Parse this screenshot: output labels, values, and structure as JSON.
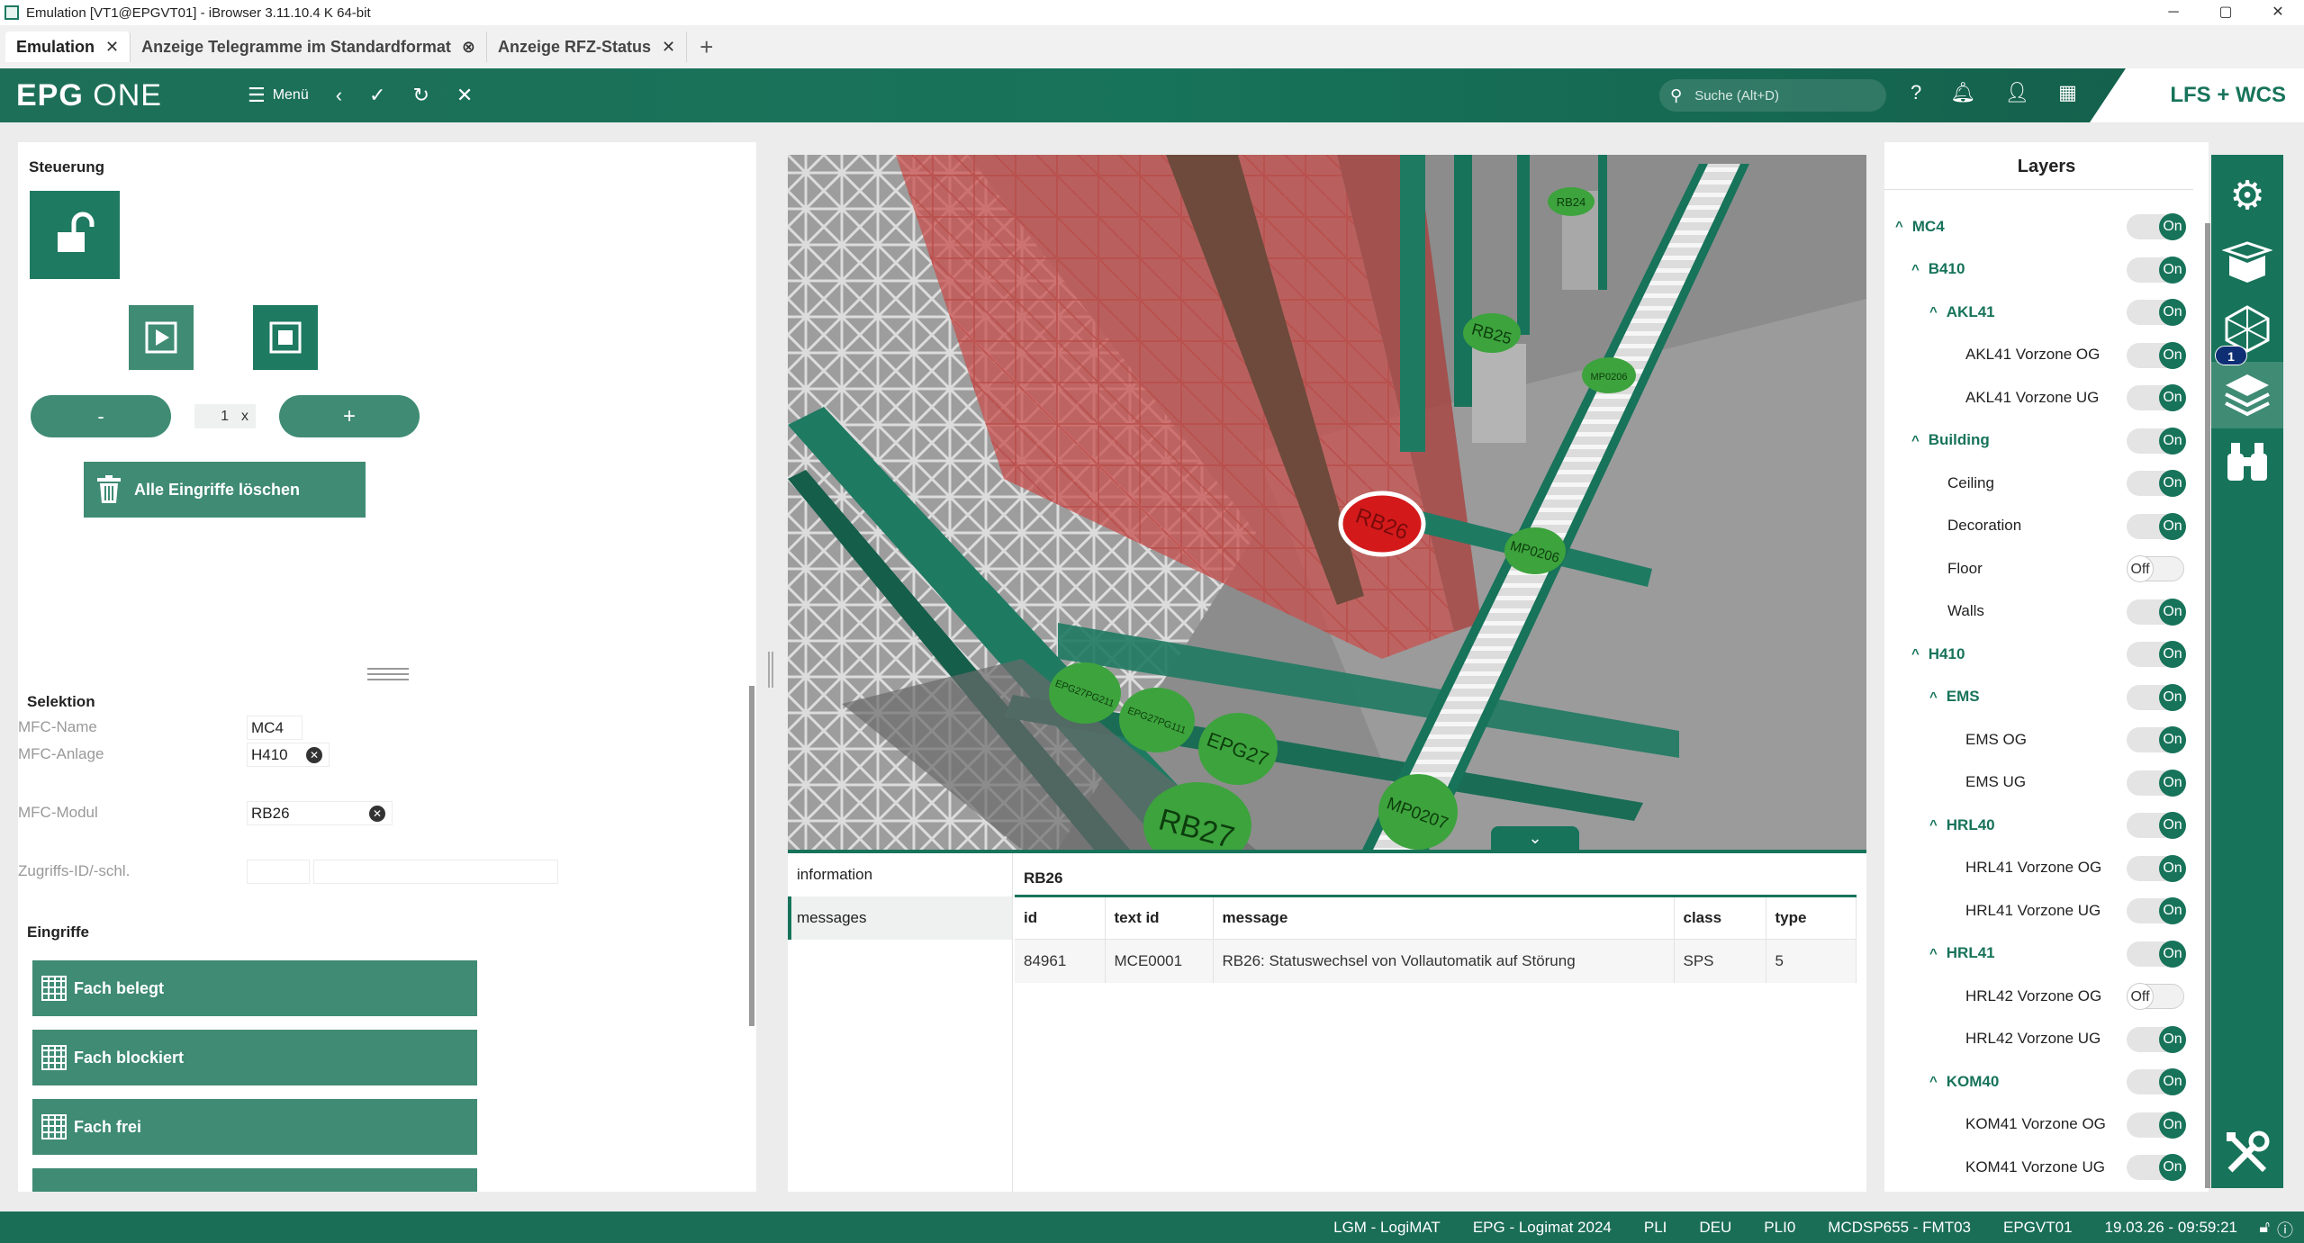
{
  "window": {
    "title": "Emulation [VT1@EPGVT01] - iBrowser 3.11.10.4 K 64-bit",
    "minimize": "─",
    "maximize": "▢",
    "close": "✕"
  },
  "tabs": [
    {
      "label": "Emulation"
    },
    {
      "label": "Anzeige Telegramme im Standardformat"
    },
    {
      "label": "Anzeige RFZ-Status"
    }
  ],
  "header": {
    "logo_bold": "EPG",
    "logo_light": "ONE",
    "menu_label": "Menü",
    "search_placeholder": "Suche (Alt+D)",
    "brand": "LFS + WCS"
  },
  "steuerung": {
    "title": "Steuerung",
    "speed_value": "1",
    "speed_unit": "x",
    "minus_label": "-",
    "plus_label": "+",
    "clear_label": "Alle Eingriffe löschen"
  },
  "selektion": {
    "title": "Selektion",
    "mfc_name_label": "MFC-Name",
    "mfc_name_value": "MC4",
    "mfc_anlage_label": "MFC-Anlage",
    "mfc_anlage_value": "H410",
    "mfc_modul_label": "MFC-Modul",
    "mfc_modul_value": "RB26",
    "zugriffs_label": "Zugriffs-ID/-schl."
  },
  "eingriffe": {
    "title": "Eingriffe",
    "buttons": [
      "Fach belegt",
      "Fach blockiert",
      "Fach frei"
    ]
  },
  "scene_labels": {
    "rb26": "RB26",
    "rb25": "RB25",
    "rb24": "RB24",
    "rb27": "RB27",
    "epg27": "EPG27",
    "mp0206a": "MP0206",
    "mp0206b": "MP0206",
    "mp0207": "MP0207",
    "epg27pg211": "EPG27PG211",
    "epg27pg111": "EPG27PG111"
  },
  "info": {
    "tabs": [
      "information",
      "messages"
    ],
    "title": "RB26",
    "columns": [
      "id",
      "text id",
      "message",
      "class",
      "type"
    ],
    "rows": [
      [
        "84961",
        "MCE0001",
        "RB26: Statuswechsel von Vollautomatik auf Störung",
        "SPS",
        "5"
      ]
    ]
  },
  "layers": {
    "title": "Layers",
    "on_label": "On",
    "off_label": "Off",
    "items": [
      {
        "label": "MC4",
        "level": 0,
        "group": true,
        "on": true
      },
      {
        "label": "B410",
        "level": 1,
        "group": true,
        "on": true
      },
      {
        "label": "AKL41",
        "level": 2,
        "group": true,
        "on": true
      },
      {
        "label": "AKL41 Vorzone OG",
        "level": 3,
        "group": false,
        "on": true
      },
      {
        "label": "AKL41 Vorzone UG",
        "level": 3,
        "group": false,
        "on": true
      },
      {
        "label": "Building",
        "level": 1,
        "group": true,
        "on": true
      },
      {
        "label": "Ceiling",
        "level": 2,
        "group": false,
        "on": true
      },
      {
        "label": "Decoration",
        "level": 2,
        "group": false,
        "on": true
      },
      {
        "label": "Floor",
        "level": 2,
        "group": false,
        "on": false
      },
      {
        "label": "Walls",
        "level": 2,
        "group": false,
        "on": true
      },
      {
        "label": "H410",
        "level": 1,
        "group": true,
        "on": true
      },
      {
        "label": "EMS",
        "level": 2,
        "group": true,
        "on": true
      },
      {
        "label": "EMS OG",
        "level": 3,
        "group": false,
        "on": true
      },
      {
        "label": "EMS UG",
        "level": 3,
        "group": false,
        "on": true
      },
      {
        "label": "HRL40",
        "level": 2,
        "group": true,
        "on": true
      },
      {
        "label": "HRL41 Vorzone OG",
        "level": 3,
        "group": false,
        "on": true
      },
      {
        "label": "HRL41 Vorzone UG",
        "level": 3,
        "group": false,
        "on": true
      },
      {
        "label": "HRL41",
        "level": 2,
        "group": true,
        "on": true
      },
      {
        "label": "HRL42 Vorzone OG",
        "level": 3,
        "group": false,
        "on": false
      },
      {
        "label": "HRL42 Vorzone UG",
        "level": 3,
        "group": false,
        "on": true
      },
      {
        "label": "KOM40",
        "level": 2,
        "group": true,
        "on": true
      },
      {
        "label": "KOM41 Vorzone OG",
        "level": 3,
        "group": false,
        "on": true
      },
      {
        "label": "KOM41 Vorzone UG",
        "level": 3,
        "group": false,
        "on": true
      }
    ]
  },
  "toolbar": {
    "badge": "1"
  },
  "statusbar": {
    "items": [
      "LGM - LogiMAT",
      "EPG - Logimat 2024",
      "PLI",
      "DEU",
      "PLI0",
      "MCDSP655 - FMT03",
      "EPGVT01",
      "19.03.26 - 09:59:21"
    ]
  },
  "colors": {
    "primary": "#17735a",
    "button": "#3f8b73",
    "danger": "#d4191b",
    "highlight": "#c8514f"
  }
}
